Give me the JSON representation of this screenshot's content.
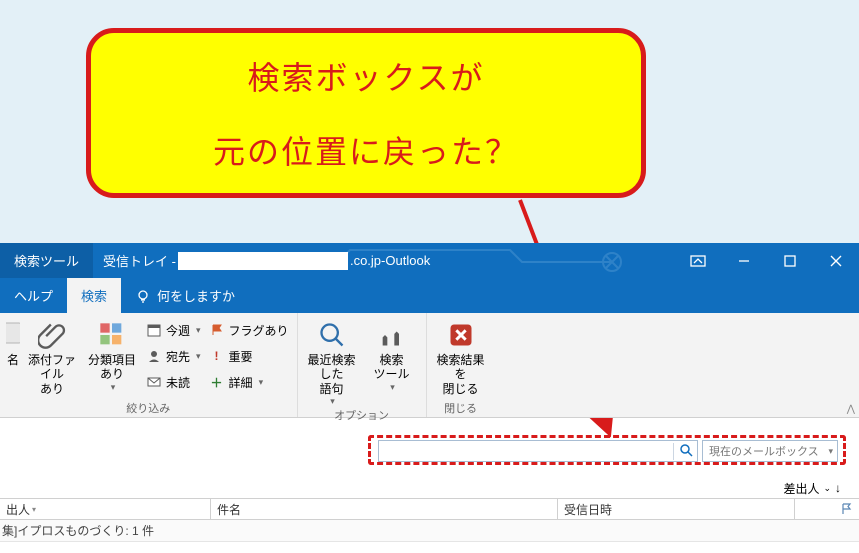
{
  "callout": {
    "line1": "検索ボックスが",
    "line2": "元の位置に戻った？"
  },
  "title": {
    "tool_tab": "検索ツール",
    "inbox_label": "受信トレイ -",
    "domain_suffix": ".co.jp",
    "separator": " - ",
    "app_name": "Outlook"
  },
  "tabs": {
    "help": "ヘルプ",
    "search": "検索",
    "tellme": "何をしますか"
  },
  "ribbon": {
    "group_narrow": "絞り込み",
    "group_options": "オプション",
    "group_close": "閉じる",
    "btn_cut_name": "名",
    "btn_attachment": "添付ファイル\nあり",
    "btn_categorized": "分類項目\nあり",
    "small_thisweek": "今週",
    "small_to": "宛先",
    "small_unread": "未読",
    "small_flagged": "フラグあり",
    "small_important": "重要",
    "small_more": "詳細",
    "btn_recent": "最近検索した\n語句",
    "btn_tools": "検索\nツール",
    "btn_closeresults": "検索結果を\n閉じる"
  },
  "search": {
    "scope": "現在のメールボックス"
  },
  "sort": {
    "label": "差出人"
  },
  "columns": {
    "sender": "出人",
    "subject": "件名",
    "date": "受信日時"
  },
  "group_header": "集]イプロスものづくり: 1 件"
}
